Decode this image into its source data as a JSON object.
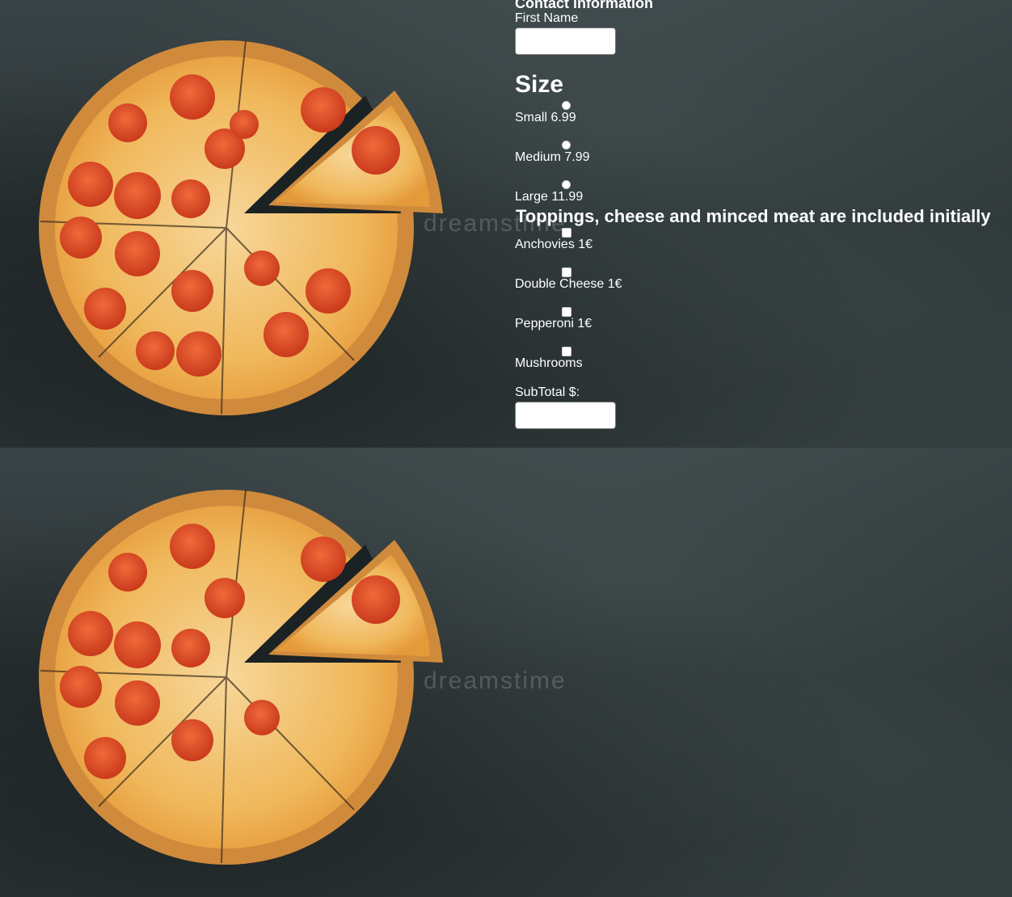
{
  "form": {
    "contact_heading": "Contact information",
    "first_name_label": "First Name",
    "first_name_value": "",
    "size_heading": "Size",
    "sizes": [
      {
        "label": "Small 6.99"
      },
      {
        "label": "Medium 7.99"
      },
      {
        "label": "Large 11.99"
      }
    ],
    "toppings_heading": "Toppings, cheese and minced meat are included initially",
    "toppings": [
      {
        "label": "Anchovies 1€"
      },
      {
        "label": "Double Cheese 1€"
      },
      {
        "label": "Pepperoni 1€"
      },
      {
        "label": "Mushrooms"
      }
    ],
    "subtotal_label": "SubTotal $:",
    "subtotal_value": ""
  },
  "background": {
    "watermark": "dreamstime"
  }
}
